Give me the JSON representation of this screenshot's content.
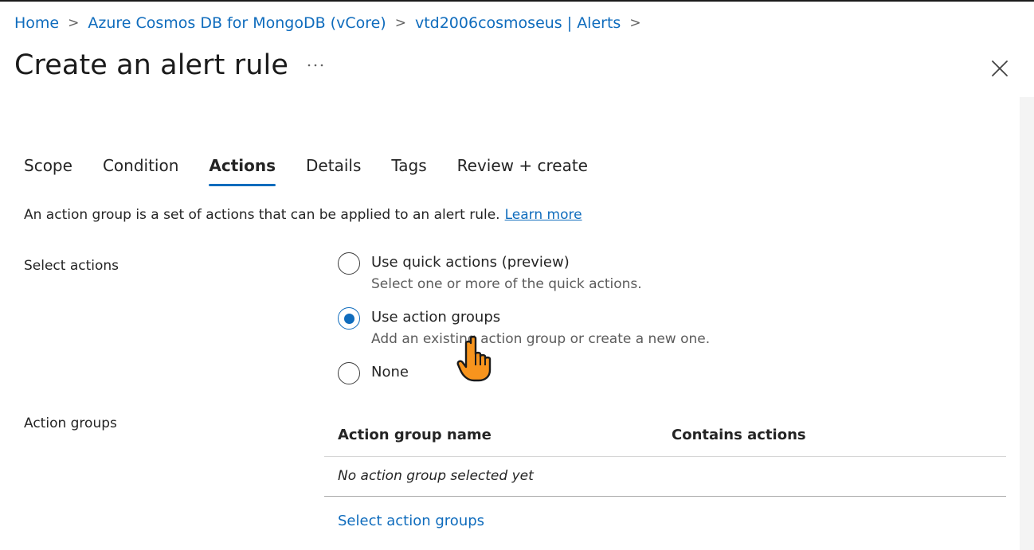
{
  "breadcrumb": {
    "items": [
      "Home",
      "Azure Cosmos DB for MongoDB (vCore)",
      "vtd2006cosmoseus | Alerts"
    ],
    "separator": ">"
  },
  "page": {
    "title": "Create an alert rule",
    "more_icon": "ellipsis-icon",
    "close_icon": "close-icon"
  },
  "tabs": [
    {
      "label": "Scope",
      "active": false
    },
    {
      "label": "Condition",
      "active": false
    },
    {
      "label": "Actions",
      "active": true
    },
    {
      "label": "Details",
      "active": false
    },
    {
      "label": "Tags",
      "active": false
    },
    {
      "label": "Review + create",
      "active": false
    }
  ],
  "intro": {
    "text": "An action group is a set of actions that can be applied to an alert rule.",
    "link": "Learn more"
  },
  "select_actions": {
    "label": "Select actions",
    "options": [
      {
        "label": "Use quick actions (preview)",
        "description": "Select one or more of the quick actions.",
        "selected": false
      },
      {
        "label": "Use action groups",
        "description": "Add an existing action group or create a new one.",
        "selected": true
      },
      {
        "label": "None",
        "description": "",
        "selected": false
      }
    ]
  },
  "action_groups": {
    "label": "Action groups",
    "columns": [
      "Action group name",
      "Contains actions"
    ],
    "empty_text": "No action group selected yet",
    "select_link": "Select action groups"
  },
  "colors": {
    "accent": "#0f6cbd",
    "cursor_fill": "#f7941d"
  }
}
